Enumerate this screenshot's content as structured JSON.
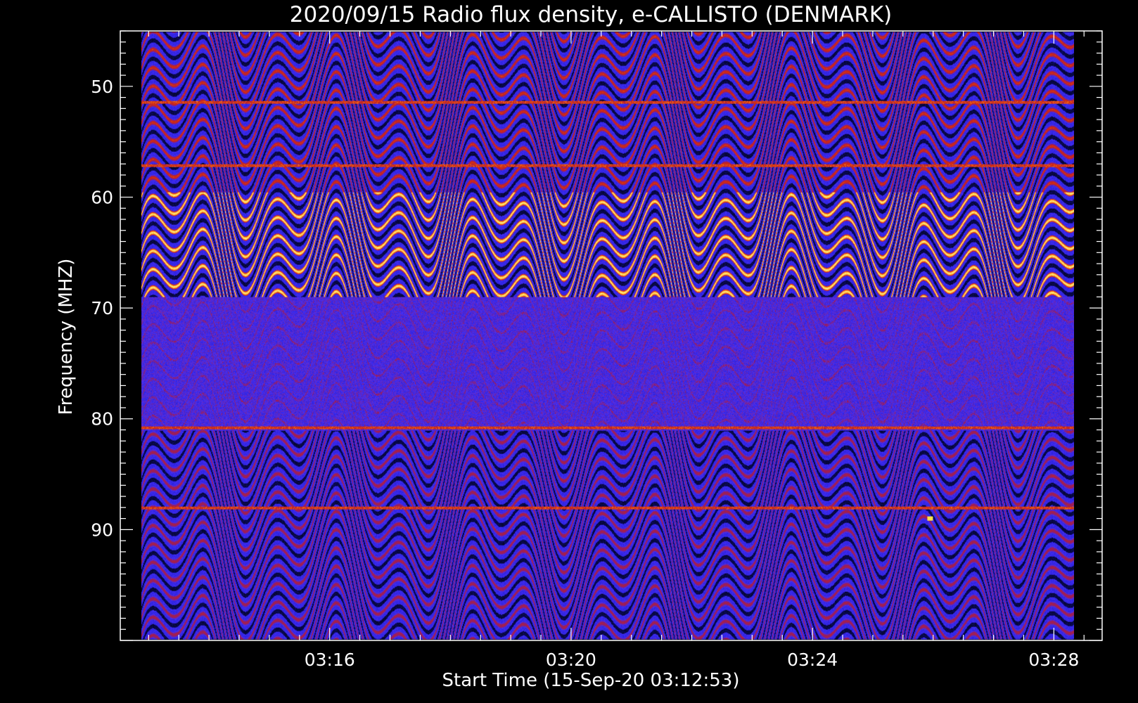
{
  "chart_data": {
    "type": "heatmap",
    "title": "2020/09/15  Radio flux density, e-CALLISTO (DENMARK)",
    "xlabel": "Start Time (15-Sep-20 03:12:53)",
    "ylabel": "Frequency (MHZ)",
    "x_unit": "minutes after 03:00 UT",
    "xlim": [
      12.53,
      28.8
    ],
    "ylim": [
      45.0,
      100.0
    ],
    "y_inverted": true,
    "data_x_range": [
      12.88,
      28.33
    ],
    "data_y_range": [
      45.1,
      99.9
    ],
    "x_ticks": [
      {
        "value": 16,
        "label": "03:16"
      },
      {
        "value": 20,
        "label": "03:20"
      },
      {
        "value": 24,
        "label": "03:24"
      },
      {
        "value": 28,
        "label": "03:28"
      }
    ],
    "y_ticks": [
      {
        "value": 50,
        "label": "50"
      },
      {
        "value": 60,
        "label": "60"
      },
      {
        "value": 70,
        "label": "70"
      },
      {
        "value": 80,
        "label": "80"
      },
      {
        "value": 90,
        "label": "90"
      }
    ],
    "colormap": [
      "#000000",
      "#1a1ad2",
      "#4830f4",
      "#8f1c6a",
      "#d2280f",
      "#ff8a18",
      "#ffee7a"
    ],
    "grid": false,
    "legend": "none",
    "features": [
      {
        "kind": "interference-band",
        "y_range": [
          59.5,
          69.0
        ],
        "intensity": 1.0
      },
      {
        "kind": "interference-band",
        "y_range": [
          45.1,
          59.5
        ],
        "intensity": 0.55
      },
      {
        "kind": "interference-band",
        "y_range": [
          81.0,
          99.9
        ],
        "intensity": 0.4
      },
      {
        "kind": "noise-band",
        "y_range": [
          69.0,
          81.0
        ],
        "intensity": 0.3
      },
      {
        "kind": "horizontal-line",
        "y": 51.4
      },
      {
        "kind": "horizontal-line",
        "y": 57.1
      },
      {
        "kind": "horizontal-line",
        "y": 80.8
      },
      {
        "kind": "horizontal-line",
        "y": 88.0
      },
      {
        "kind": "spike",
        "x": 25.95,
        "y": 89.0
      }
    ]
  },
  "colors": {
    "background": "#000000",
    "axes": "#ffffff",
    "band_low": "#1a1ad2",
    "band_high": "#ff8a18"
  }
}
